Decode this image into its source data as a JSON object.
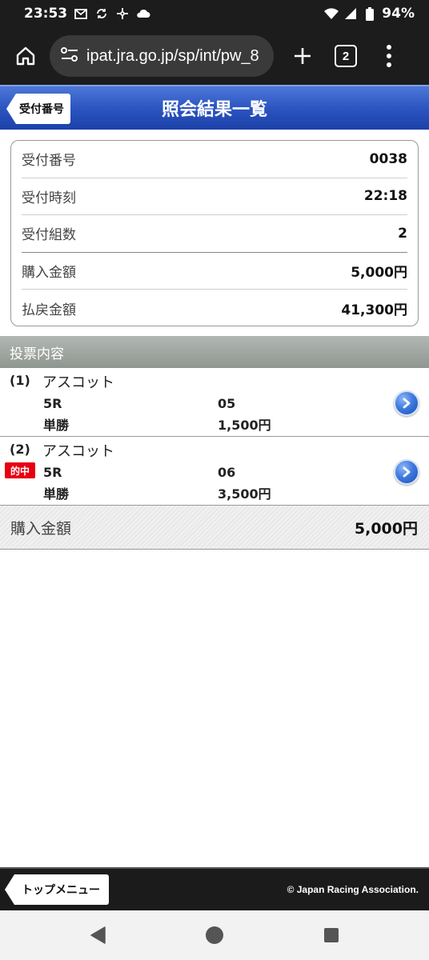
{
  "status_bar": {
    "time": "23:53",
    "battery": "94%",
    "icons": [
      "gmail-icon",
      "sync-icon",
      "pinwheel-icon",
      "cloud-icon",
      "wifi-icon",
      "signal-icon",
      "battery-icon"
    ]
  },
  "browser": {
    "url": "ipat.jra.go.jp/sp/int/pw_8",
    "tab_count": "2"
  },
  "header": {
    "back_label": "受付番号",
    "title": "照会結果一覧",
    "color": "#2c55c1"
  },
  "summary": [
    {
      "label": "受付番号",
      "value": "0038"
    },
    {
      "label": "受付時刻",
      "value": "22:18"
    },
    {
      "label": "受付組数",
      "value": "2"
    },
    {
      "label": "購入金額",
      "value": "5,000円"
    },
    {
      "label": "払戻金額",
      "value": "41,300円"
    }
  ],
  "section_title": "投票内容",
  "bets": [
    {
      "num": "(1)",
      "venue": "アスコット",
      "race": "5R",
      "horse": "05",
      "type": "単勝",
      "amount": "1,500円",
      "hit": ""
    },
    {
      "num": "(2)",
      "venue": "アスコット",
      "race": "5R",
      "horse": "06",
      "type": "単勝",
      "amount": "3,500円",
      "hit": "的中"
    }
  ],
  "total": {
    "label": "購入金額",
    "value": "5,000円"
  },
  "footer": {
    "top_menu_label": "トップメニュー",
    "copyright": "© Japan Racing Association."
  },
  "hit_color": "#e60012"
}
